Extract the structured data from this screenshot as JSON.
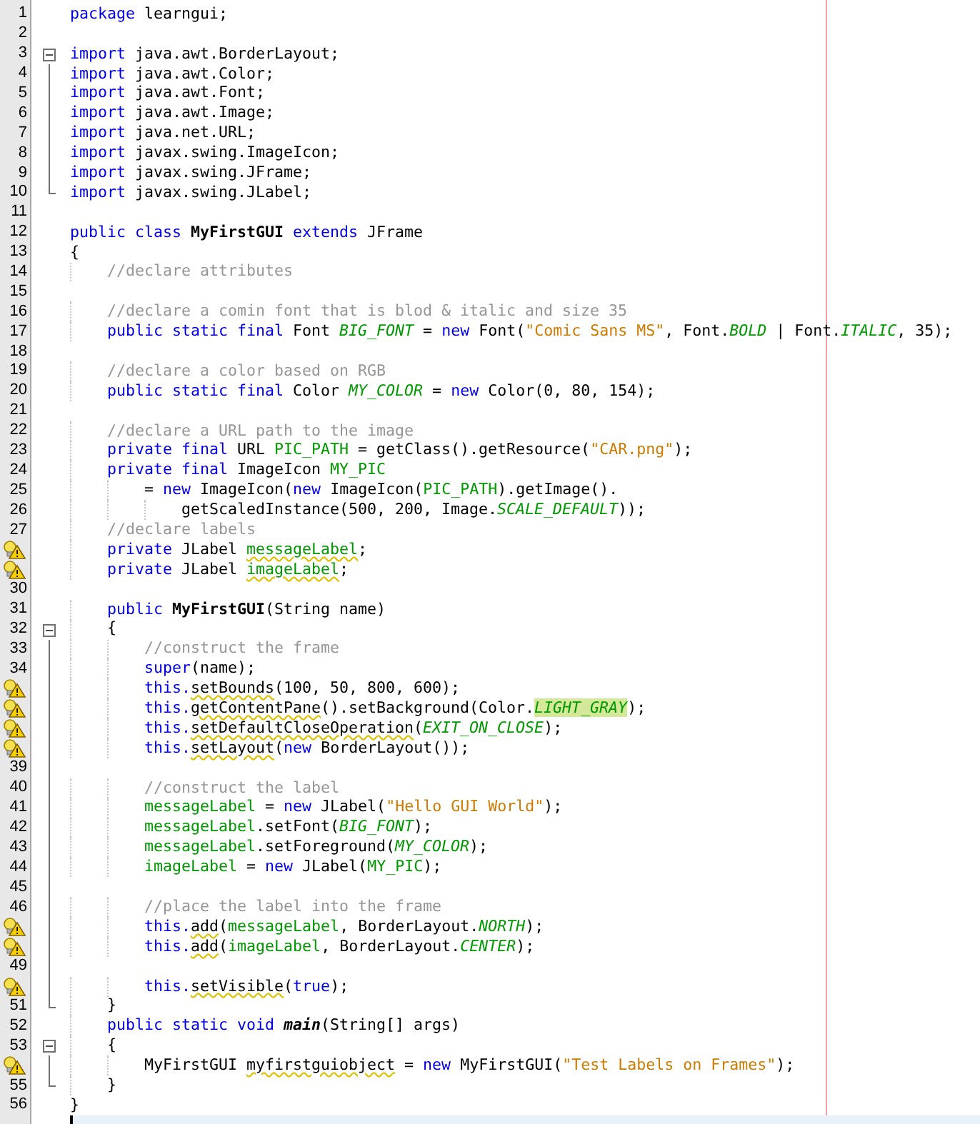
{
  "editor": {
    "lines": [
      {
        "number": "1",
        "hint": false,
        "kind": "plain",
        "tokens": [
          {
            "kind": "kw",
            "text": "package"
          },
          {
            "kind": "plain",
            "text": " learngui;"
          }
        ]
      },
      {
        "number": "2",
        "hint": false,
        "kind": "plain"
      },
      {
        "number": "3",
        "hint": false,
        "kind": "fold_start",
        "tokens": [
          {
            "kind": "kw",
            "text": "import"
          },
          {
            "kind": "plain",
            "text": " java.awt.BorderLayout;"
          }
        ]
      },
      {
        "number": "4",
        "hint": false,
        "kind": "fold_inside",
        "tokens": [
          {
            "kind": "kw",
            "text": "import"
          },
          {
            "kind": "plain",
            "text": " java.awt.Color;"
          }
        ]
      },
      {
        "number": "5",
        "hint": false,
        "kind": "fold_inside",
        "tokens": [
          {
            "kind": "kw",
            "text": "import"
          },
          {
            "kind": "plain",
            "text": " java.awt.Font;"
          }
        ]
      },
      {
        "number": "6",
        "hint": false,
        "kind": "fold_inside",
        "tokens": [
          {
            "kind": "kw",
            "text": "import"
          },
          {
            "kind": "plain",
            "text": " java.awt.Image;"
          }
        ]
      },
      {
        "number": "7",
        "hint": false,
        "kind": "fold_inside",
        "tokens": [
          {
            "kind": "kw",
            "text": "import"
          },
          {
            "kind": "plain",
            "text": " java.net.URL;"
          }
        ]
      },
      {
        "number": "8",
        "hint": false,
        "kind": "fold_inside",
        "tokens": [
          {
            "kind": "kw",
            "text": "import"
          },
          {
            "kind": "plain",
            "text": " javax.swing.ImageIcon;"
          }
        ]
      },
      {
        "number": "9",
        "hint": false,
        "kind": "fold_inside",
        "tokens": [
          {
            "kind": "kw",
            "text": "import"
          },
          {
            "kind": "plain",
            "text": " javax.swing.JFrame;"
          }
        ]
      },
      {
        "number": "10",
        "hint": false,
        "kind": "fold_end",
        "tokens": [
          {
            "kind": "kw",
            "text": "import"
          },
          {
            "kind": "plain",
            "text": " javax.swing.JLabel;"
          }
        ]
      },
      {
        "number": "11",
        "hint": false,
        "kind": "plain"
      },
      {
        "number": "12",
        "hint": false,
        "kind": "plain",
        "tokens": [
          {
            "kind": "kw",
            "text": "public class"
          },
          {
            "kind": "decl",
            "text": " MyFirstGUI"
          },
          {
            "kind": "kw",
            "text": " extends"
          },
          {
            "kind": "plain",
            "text": " JFrame"
          }
        ]
      },
      {
        "number": "13",
        "hint": false,
        "kind": "plain",
        "tokens": [
          {
            "kind": "plain",
            "text": "{"
          }
        ]
      },
      {
        "number": "14",
        "hint": false,
        "kind": "plain",
        "tokens": [
          {
            "kind": "comment",
            "text": "    //declare attributes"
          }
        ]
      },
      {
        "number": "15",
        "hint": false,
        "kind": "plain"
      },
      {
        "number": "16",
        "hint": false,
        "kind": "plain",
        "tokens": [
          {
            "kind": "comment",
            "text": "    //declare a comin font that is blod & italic and size 35"
          }
        ]
      },
      {
        "number": "17",
        "hint": false,
        "kind": "plain",
        "tokens": [
          {
            "kind": "kw",
            "text": "    public static final"
          },
          {
            "kind": "plain",
            "text": " Font "
          },
          {
            "kind": "const",
            "text": "BIG_FONT"
          },
          {
            "kind": "plain",
            "text": " = "
          },
          {
            "kind": "kw",
            "text": "new"
          },
          {
            "kind": "plain",
            "text": " Font("
          },
          {
            "kind": "string",
            "text": "\"Comic Sans MS\""
          },
          {
            "kind": "plain",
            "text": ", Font."
          },
          {
            "kind": "const",
            "text": "BOLD"
          },
          {
            "kind": "plain",
            "text": " | Font."
          },
          {
            "kind": "const",
            "text": "ITALIC"
          },
          {
            "kind": "plain",
            "text": ", 35);"
          }
        ]
      },
      {
        "number": "18",
        "hint": false,
        "kind": "plain"
      },
      {
        "number": "19",
        "hint": false,
        "kind": "plain",
        "tokens": [
          {
            "kind": "comment",
            "text": "    //declare a color based on RGB"
          }
        ]
      },
      {
        "number": "20",
        "hint": false,
        "kind": "plain",
        "tokens": [
          {
            "kind": "kw",
            "text": "    public static final"
          },
          {
            "kind": "plain",
            "text": " Color "
          },
          {
            "kind": "const",
            "text": "MY_COLOR"
          },
          {
            "kind": "plain",
            "text": " = "
          },
          {
            "kind": "kw",
            "text": "new"
          },
          {
            "kind": "plain",
            "text": " Color(0, 80, 154);"
          }
        ]
      },
      {
        "number": "21",
        "hint": false,
        "kind": "plain"
      },
      {
        "number": "22",
        "hint": false,
        "kind": "plain",
        "tokens": [
          {
            "kind": "comment",
            "text": "    //declare a URL path to the image"
          }
        ]
      },
      {
        "number": "23",
        "hint": false,
        "kind": "plain",
        "tokens": [
          {
            "kind": "kw",
            "text": "    private final"
          },
          {
            "kind": "plain",
            "text": " URL "
          },
          {
            "kind": "field",
            "text": "PIC_PATH"
          },
          {
            "kind": "plain",
            "text": " = getClass().getResource("
          },
          {
            "kind": "string",
            "text": "\"CAR.png\""
          },
          {
            "kind": "plain",
            "text": ");"
          }
        ]
      },
      {
        "number": "24",
        "hint": false,
        "kind": "plain",
        "tokens": [
          {
            "kind": "kw",
            "text": "    private final"
          },
          {
            "kind": "plain",
            "text": " ImageIcon "
          },
          {
            "kind": "field",
            "text": "MY_PIC"
          }
        ]
      },
      {
        "number": "25",
        "hint": false,
        "kind": "plain",
        "tokens": [
          {
            "kind": "plain",
            "text": "        = "
          },
          {
            "kind": "kw",
            "text": "new"
          },
          {
            "kind": "plain",
            "text": " ImageIcon("
          },
          {
            "kind": "kw",
            "text": "new"
          },
          {
            "kind": "plain",
            "text": " ImageIcon("
          },
          {
            "kind": "field",
            "text": "PIC_PATH"
          },
          {
            "kind": "plain",
            "text": ").getImage()."
          }
        ]
      },
      {
        "number": "26",
        "hint": false,
        "kind": "plain",
        "tokens": [
          {
            "kind": "plain",
            "text": "            getScaledInstance(500, 200, Image."
          },
          {
            "kind": "const",
            "text": "SCALE_DEFAULT"
          },
          {
            "kind": "plain",
            "text": "));"
          }
        ]
      },
      {
        "number": "27",
        "hint": false,
        "kind": "plain",
        "tokens": [
          {
            "kind": "comment",
            "text": "    //declare labels"
          }
        ]
      },
      {
        "hint": true,
        "kind": "plain",
        "tokens": [
          {
            "kind": "kw",
            "text": "    private"
          },
          {
            "kind": "plain",
            "text": " JLabel "
          },
          {
            "kind": "field",
            "text": "messageLabel",
            "warn": true
          },
          {
            "kind": "plain",
            "text": ";"
          }
        ]
      },
      {
        "hint": true,
        "kind": "plain",
        "tokens": [
          {
            "kind": "kw",
            "text": "    private"
          },
          {
            "kind": "plain",
            "text": " JLabel "
          },
          {
            "kind": "field",
            "text": "imageLabel",
            "warn": true
          },
          {
            "kind": "plain",
            "text": ";"
          }
        ]
      },
      {
        "number": "30",
        "hint": false,
        "kind": "plain"
      },
      {
        "number": "31",
        "hint": false,
        "kind": "plain",
        "tokens": [
          {
            "kind": "kw",
            "text": "    public"
          },
          {
            "kind": "decl",
            "text": " MyFirstGUI"
          },
          {
            "kind": "plain",
            "text": "(String name)"
          }
        ]
      },
      {
        "number": "32",
        "hint": false,
        "kind": "fold_start",
        "tokens": [
          {
            "kind": "plain",
            "text": "    {"
          }
        ]
      },
      {
        "number": "33",
        "hint": false,
        "kind": "fold_inside",
        "tokens": [
          {
            "kind": "comment",
            "text": "        //construct the frame"
          }
        ]
      },
      {
        "number": "34",
        "hint": false,
        "kind": "fold_inside",
        "tokens": [
          {
            "kind": "kw",
            "text": "        super"
          },
          {
            "kind": "plain",
            "text": "(name);"
          }
        ]
      },
      {
        "hint": true,
        "kind": "fold_inside",
        "tokens": [
          {
            "kind": "kw",
            "text": "        this."
          },
          {
            "kind": "plain",
            "text": "setBounds",
            "warn": true
          },
          {
            "kind": "plain",
            "text": "(100, 50, 800, 600);"
          }
        ]
      },
      {
        "hint": true,
        "kind": "fold_inside",
        "tokens": [
          {
            "kind": "kw",
            "text": "        this."
          },
          {
            "kind": "plain",
            "text": "getContentPane",
            "warn": true
          },
          {
            "kind": "plain",
            "text": "().setBackground(Color."
          },
          {
            "kind": "const",
            "text": "LIGHT_GRAY",
            "mark": true
          },
          {
            "kind": "plain",
            "text": ");"
          }
        ]
      },
      {
        "hint": true,
        "kind": "fold_inside",
        "tokens": [
          {
            "kind": "kw",
            "text": "        this."
          },
          {
            "kind": "plain",
            "text": "setDefaultCloseOperation",
            "warn": true
          },
          {
            "kind": "plain",
            "text": "("
          },
          {
            "kind": "const",
            "text": "EXIT_ON_CLOSE"
          },
          {
            "kind": "plain",
            "text": ");"
          }
        ]
      },
      {
        "hint": true,
        "kind": "fold_inside",
        "tokens": [
          {
            "kind": "kw",
            "text": "        this."
          },
          {
            "kind": "plain",
            "text": "setLayout",
            "warn": true
          },
          {
            "kind": "plain",
            "text": "("
          },
          {
            "kind": "kw",
            "text": "new"
          },
          {
            "kind": "plain",
            "text": " BorderLayout());"
          }
        ]
      },
      {
        "number": "39",
        "hint": false,
        "kind": "fold_inside"
      },
      {
        "number": "40",
        "hint": false,
        "kind": "fold_inside",
        "tokens": [
          {
            "kind": "comment",
            "text": "        //construct the label"
          }
        ]
      },
      {
        "number": "41",
        "hint": false,
        "kind": "fold_inside",
        "tokens": [
          {
            "kind": "field",
            "text": "        messageLabel"
          },
          {
            "kind": "plain",
            "text": " = "
          },
          {
            "kind": "kw",
            "text": "new"
          },
          {
            "kind": "plain",
            "text": " JLabel("
          },
          {
            "kind": "string",
            "text": "\"Hello GUI World\""
          },
          {
            "kind": "plain",
            "text": ");"
          }
        ]
      },
      {
        "number": "42",
        "hint": false,
        "kind": "fold_inside",
        "tokens": [
          {
            "kind": "field",
            "text": "        messageLabel"
          },
          {
            "kind": "plain",
            "text": ".setFont("
          },
          {
            "kind": "const",
            "text": "BIG_FONT"
          },
          {
            "kind": "plain",
            "text": ");"
          }
        ]
      },
      {
        "number": "43",
        "hint": false,
        "kind": "fold_inside",
        "tokens": [
          {
            "kind": "field",
            "text": "        messageLabel"
          },
          {
            "kind": "plain",
            "text": ".setForeground("
          },
          {
            "kind": "const",
            "text": "MY_COLOR"
          },
          {
            "kind": "plain",
            "text": ");"
          }
        ]
      },
      {
        "number": "44",
        "hint": false,
        "kind": "fold_inside",
        "tokens": [
          {
            "kind": "field",
            "text": "        imageLabel"
          },
          {
            "kind": "plain",
            "text": " = "
          },
          {
            "kind": "kw",
            "text": "new"
          },
          {
            "kind": "plain",
            "text": " JLabel("
          },
          {
            "kind": "field",
            "text": "MY_PIC"
          },
          {
            "kind": "plain",
            "text": ");"
          }
        ]
      },
      {
        "number": "45",
        "hint": false,
        "kind": "fold_inside"
      },
      {
        "number": "46",
        "hint": false,
        "kind": "fold_inside",
        "tokens": [
          {
            "kind": "comment",
            "text": "        //place the label into the frame"
          }
        ]
      },
      {
        "hint": true,
        "kind": "fold_inside",
        "tokens": [
          {
            "kind": "kw",
            "text": "        this."
          },
          {
            "kind": "plain",
            "text": "add",
            "warn": true
          },
          {
            "kind": "plain",
            "text": "("
          },
          {
            "kind": "field",
            "text": "messageLabel"
          },
          {
            "kind": "plain",
            "text": ", BorderLayout."
          },
          {
            "kind": "const",
            "text": "NORTH"
          },
          {
            "kind": "plain",
            "text": ");"
          }
        ]
      },
      {
        "hint": true,
        "kind": "fold_inside",
        "tokens": [
          {
            "kind": "kw",
            "text": "        this."
          },
          {
            "kind": "plain",
            "text": "add",
            "warn": true
          },
          {
            "kind": "plain",
            "text": "("
          },
          {
            "kind": "field",
            "text": "imageLabel"
          },
          {
            "kind": "plain",
            "text": ", BorderLayout."
          },
          {
            "kind": "const",
            "text": "CENTER"
          },
          {
            "kind": "plain",
            "text": ");"
          }
        ]
      },
      {
        "number": "49",
        "hint": false,
        "kind": "fold_inside"
      },
      {
        "hint": true,
        "kind": "fold_inside",
        "tokens": [
          {
            "kind": "kw",
            "text": "        this."
          },
          {
            "kind": "plain",
            "text": "setVisible",
            "warn": true
          },
          {
            "kind": "plain",
            "text": "("
          },
          {
            "kind": "kw",
            "text": "true"
          },
          {
            "kind": "plain",
            "text": ");"
          }
        ]
      },
      {
        "number": "51",
        "hint": false,
        "kind": "fold_end",
        "tokens": [
          {
            "kind": "plain",
            "text": "    }"
          }
        ]
      },
      {
        "number": "52",
        "hint": false,
        "kind": "plain",
        "tokens": [
          {
            "kind": "kw",
            "text": "    public static void"
          },
          {
            "kind": "method",
            "text": " main"
          },
          {
            "kind": "plain",
            "text": "(String[] args)"
          }
        ]
      },
      {
        "number": "53",
        "hint": false,
        "kind": "fold_start",
        "tokens": [
          {
            "kind": "plain",
            "text": "    {"
          }
        ]
      },
      {
        "hint": true,
        "kind": "fold_inside",
        "tokens": [
          {
            "kind": "plain",
            "text": "        MyFirstGUI "
          },
          {
            "kind": "plain",
            "text": "myfirstguiobject",
            "warn": true
          },
          {
            "kind": "plain",
            "text": " = "
          },
          {
            "kind": "kw",
            "text": "new"
          },
          {
            "kind": "plain",
            "text": " MyFirstGUI("
          },
          {
            "kind": "string",
            "text": "\"Test Labels on Frames\""
          },
          {
            "kind": "plain",
            "text": ");"
          }
        ]
      },
      {
        "number": "55",
        "hint": false,
        "kind": "fold_end",
        "tokens": [
          {
            "kind": "plain",
            "text": "    }"
          }
        ]
      },
      {
        "number": "56",
        "hint": false,
        "kind": "plain",
        "tokens": [
          {
            "kind": "plain",
            "text": "}"
          }
        ]
      }
    ],
    "cursor": {
      "visible": true
    }
  }
}
